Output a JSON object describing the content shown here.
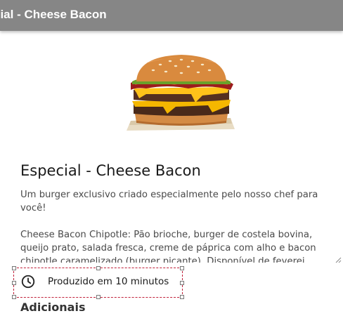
{
  "topbar": {
    "title": "cial - Cheese Bacon"
  },
  "product": {
    "image": "cheeseburger-image",
    "title": "Especial - Cheese Bacon",
    "description": "Um burger exclusivo criado especialmente pelo nosso chef para você!\n\nCheese Bacon Chipotle: Pão brioche, burger de costela bovina, queijo prato, salada fresca, creme de páprica com alho e bacon chipotle caramelizado (burger picante). Disponível de feverei"
  },
  "prep_time": {
    "icon": "clock-icon",
    "label": "Produzido em 10 minutos"
  },
  "extras": {
    "title": "Adicionais"
  }
}
